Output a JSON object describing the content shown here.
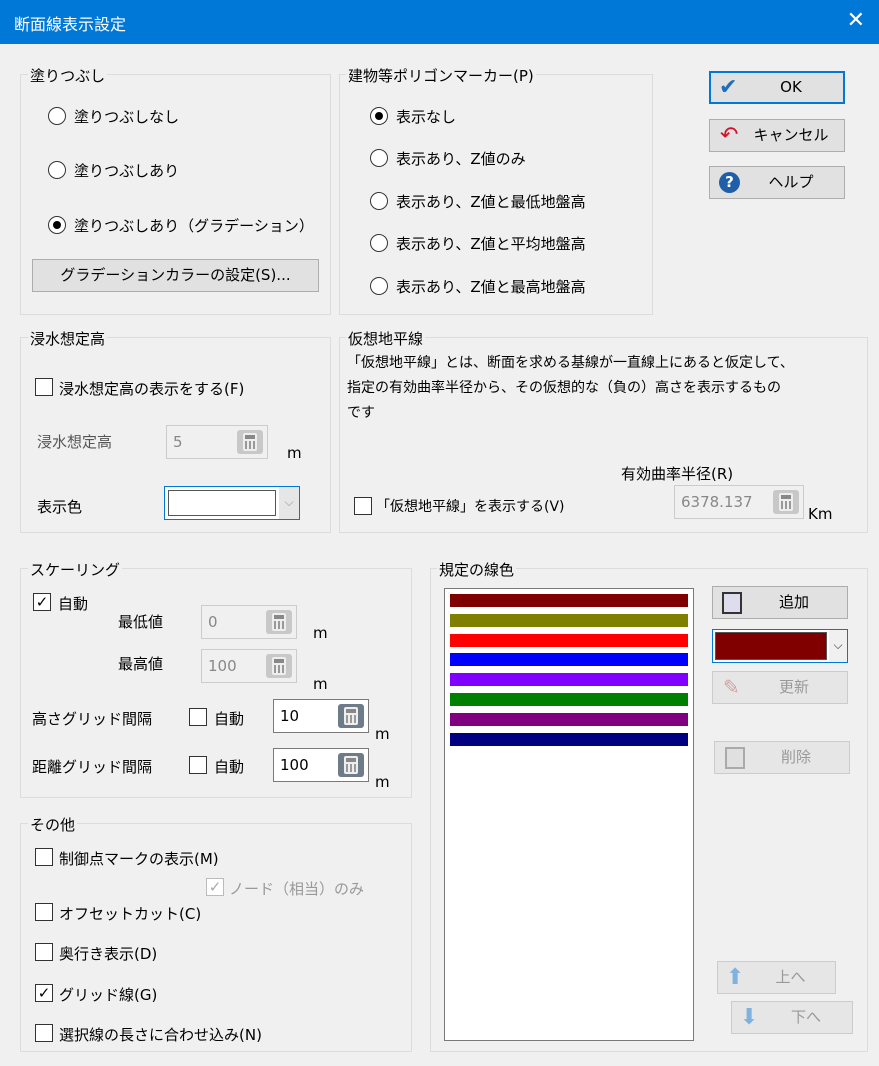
{
  "dialog": {
    "title": "断面線表示設定",
    "close_glyph": "✕"
  },
  "fill": {
    "label": "塗りつぶし",
    "options": [
      "塗りつぶしなし",
      "塗りつぶしあり",
      "塗りつぶしあり（グラデーション）"
    ],
    "selected": 2,
    "gradient_button": "グラデーションカラーの設定(S)..."
  },
  "marker": {
    "label": "建物等ポリゴンマーカー(P)",
    "options": [
      "表示なし",
      "表示あり、Z値のみ",
      "表示あり、Z値と最低地盤高",
      "表示あり、Z値と平均地盤高",
      "表示あり、Z値と最高地盤高"
    ],
    "selected": 0
  },
  "actions": {
    "ok": "OK",
    "cancel": "キャンセル",
    "help": "ヘルプ"
  },
  "flood": {
    "label": "浸水想定高",
    "show_check": "浸水想定高の表示をする(F)",
    "height_label": "浸水想定高",
    "height_value": "5",
    "unit": "m",
    "color_label": "表示色",
    "color_value": "#ffffff"
  },
  "horizon": {
    "label": "仮想地平線",
    "description_1": "「仮想地平線」とは、断面を求める基線が一直線上にあると仮定して、",
    "description_2": "指定の有効曲率半径から、その仮想的な（負の）高さを表示するもの",
    "description_3": "です",
    "radius_label": "有効曲率半径(R)",
    "show_check": "「仮想地平線」を表示する(V)",
    "radius_value": "6378.137",
    "unit": "Km"
  },
  "scaling": {
    "label": "スケーリング",
    "auto_label": "自動",
    "auto_checked": true,
    "min_label": "最低値",
    "min_value": "0",
    "max_label": "最高値",
    "max_value": "100",
    "unit": "m",
    "height_grid_label": "高さグリッド間隔",
    "height_grid_auto": "自動",
    "height_grid_value": "10",
    "dist_grid_label": "距離グリッド間隔",
    "dist_grid_auto": "自動",
    "dist_grid_value": "100",
    "check_glyph": "✓"
  },
  "other": {
    "label": "その他",
    "control_mark": "制御点マークの表示(M)",
    "node_only": "ノード（相当）のみ",
    "offset_cut": "オフセットカット(C)",
    "depth": "奥行き表示(D)",
    "grid_line": "グリッド線(G)",
    "fit_length": "選択線の長さに合わせ込み(N)",
    "grid_checked": true
  },
  "line_colors": {
    "label": "規定の線色",
    "colors": [
      "#800000",
      "#808000",
      "#ff0000",
      "#0000ff",
      "#8000ff",
      "#008000",
      "#800080",
      "#000080"
    ],
    "selected_color": "#800000",
    "add": "追加",
    "update": "更新",
    "delete": "削除",
    "up": "上へ",
    "down": "下へ"
  }
}
